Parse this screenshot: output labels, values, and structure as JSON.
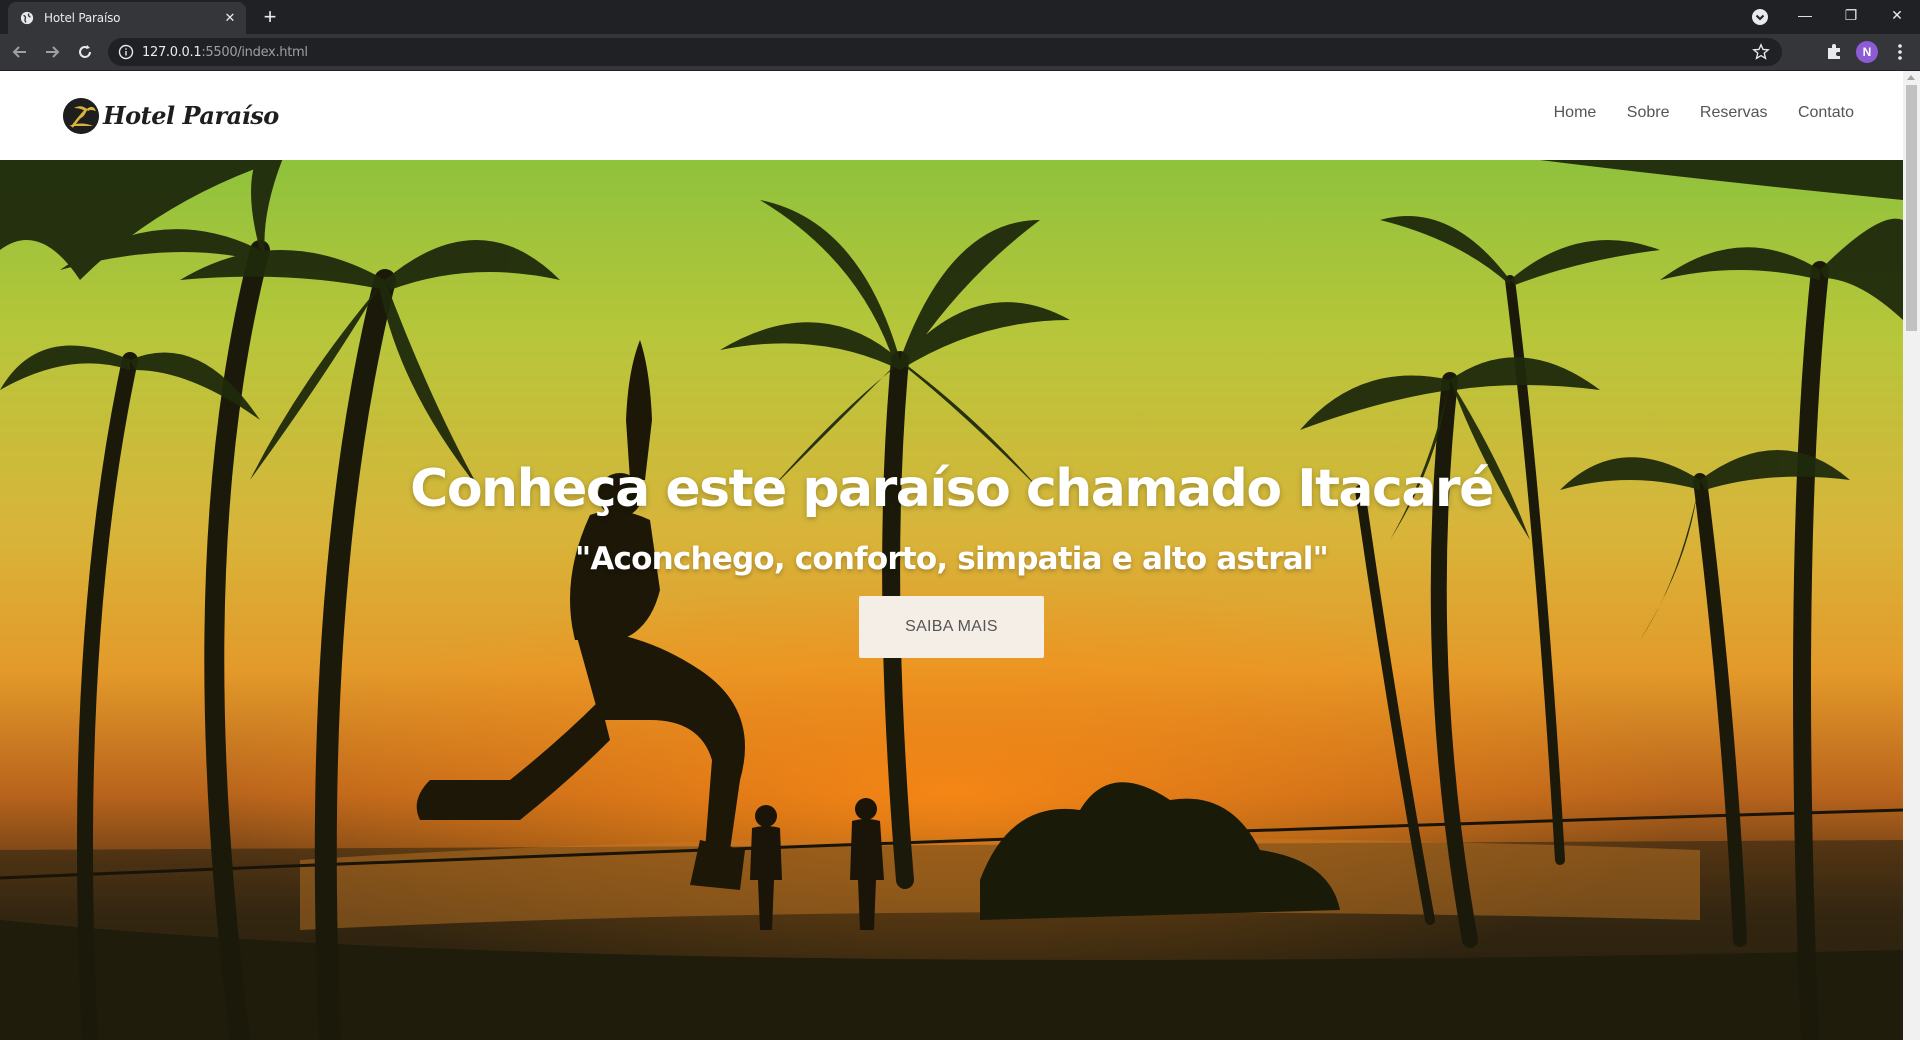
{
  "browser": {
    "tab_title": "Hotel Paraíso",
    "url_host": "127.0.0.1",
    "url_rest": ":5500/index.html",
    "profile_initial": "N"
  },
  "site": {
    "logo_text": "Hotel Paraíso",
    "nav": [
      {
        "label": "Home"
      },
      {
        "label": "Sobre"
      },
      {
        "label": "Reservas"
      },
      {
        "label": "Contato"
      }
    ]
  },
  "hero": {
    "title": "Conheça este paraíso chamado Itacaré",
    "subtitle": "\"Aconchego, conforto, simpatia e alto astral\"",
    "button_label": "SAIBA MAIS"
  },
  "colors": {
    "hero_button_bg": "#f5eee6",
    "hero_text": "#ffffff",
    "nav_text": "#555555",
    "avatar_bg": "#8e5bd6"
  }
}
